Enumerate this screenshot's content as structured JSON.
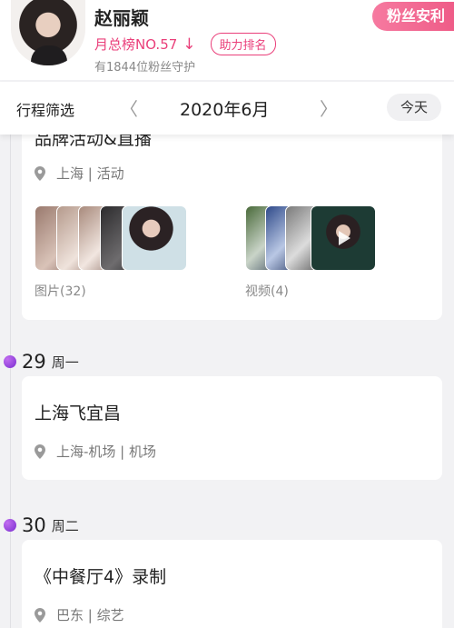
{
  "header": {
    "star_name": "赵丽颖",
    "rank_text": "月总榜NO.57",
    "rank_arrow": "↓",
    "help_button": "助力排名",
    "fans_text": "有1844位粉丝守护",
    "fan_benefit_button": "粉丝安利"
  },
  "filter_bar": {
    "label": "行程筛选",
    "prev": "〈",
    "month": "2020年6月",
    "next": "〉",
    "today_button": "今天"
  },
  "events": [
    {
      "title": "品牌活动&直播",
      "location": "上海 | 活动",
      "photos_label": "图片(32)",
      "videos_label": "视频(4)"
    }
  ],
  "days": [
    {
      "day": "29",
      "weekday": "周一",
      "title": "上海飞宜昌",
      "location": "上海-机场 | 机场"
    },
    {
      "day": "30",
      "weekday": "周二",
      "title": "《中餐厅4》录制",
      "location": "巴东 | 综艺"
    }
  ],
  "colors": {
    "accent_pink": "#ea3f7a",
    "day_dot": "#8a3fd8"
  },
  "icons": {
    "location": "map-pin-icon",
    "play": "play-icon"
  }
}
